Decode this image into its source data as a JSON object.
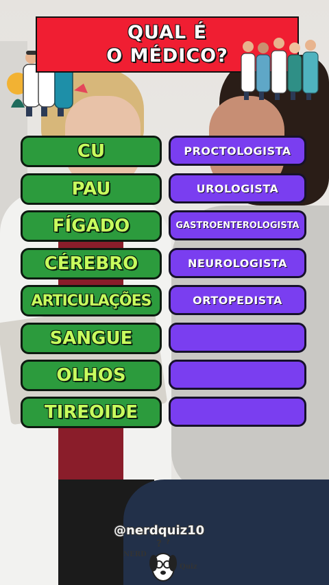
{
  "title": {
    "line1": "QUAL É",
    "line2": "O MÉDICO?"
  },
  "rows": [
    {
      "word": "CU",
      "answer": "PROCTOLOGISTA"
    },
    {
      "word": "PAU",
      "answer": "UROLOGISTA"
    },
    {
      "word": "FÍGADO",
      "answer": "GASTROENTEROLOGISTA"
    },
    {
      "word": "CÉREBRO",
      "answer": "NEUROLOGISTA"
    },
    {
      "word": "ARTICULAÇÕES",
      "answer": "ORTOPEDISTA"
    },
    {
      "word": "SANGUE",
      "answer": ""
    },
    {
      "word": "OLHOS",
      "answer": ""
    },
    {
      "word": "TIREOIDE",
      "answer": ""
    }
  ],
  "watermark": {
    "handle": "@nerdquiz10",
    "logo_text_left": "NERD",
    "logo_text_right": "Quiz"
  },
  "colors": {
    "title_bg": "#f01e32",
    "word_bg": "#2c9b3d",
    "word_text": "#c8ff5e",
    "answer_bg": "#7a3ef0"
  },
  "icons": {
    "left": "doctors-group-illustration",
    "right": "medical-team-illustration",
    "logo": "nerd-dog-logo"
  }
}
